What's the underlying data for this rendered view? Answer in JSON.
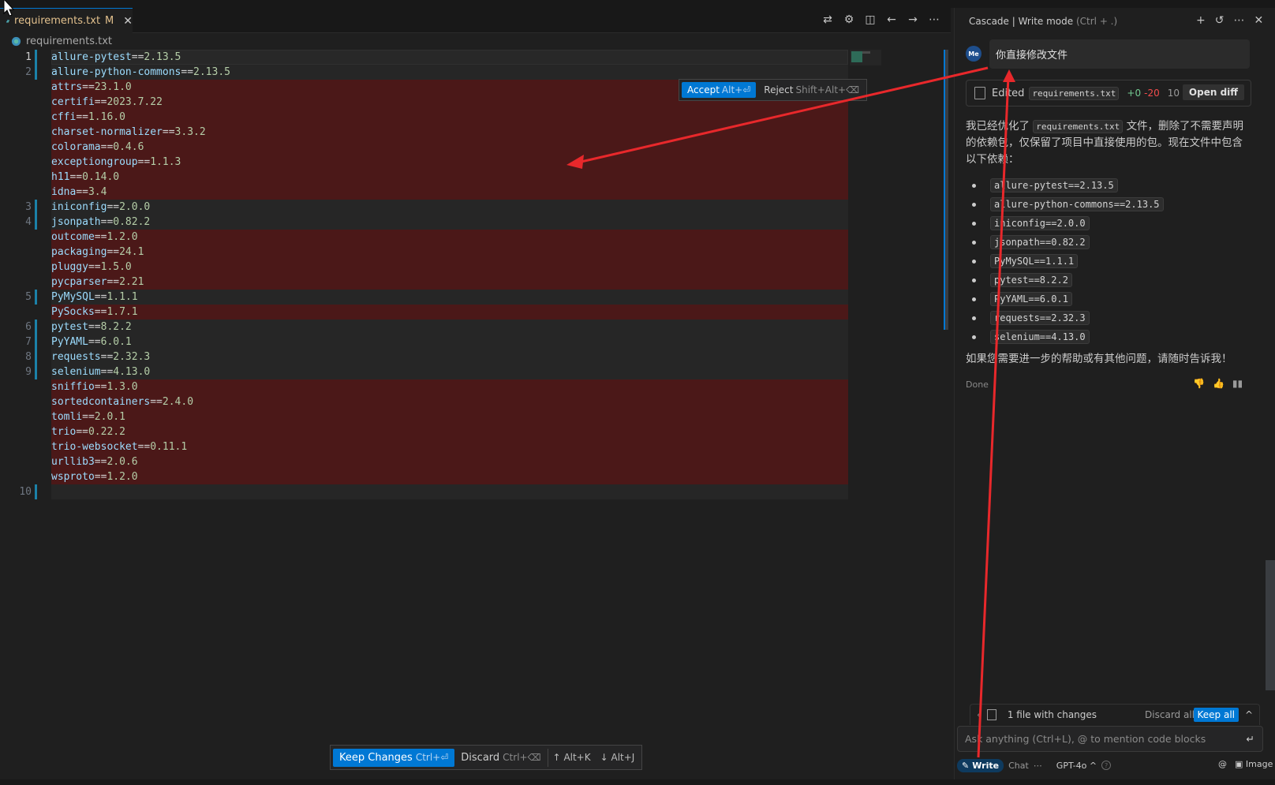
{
  "editor": {
    "tab": {
      "filename": "requirements.txt",
      "modified": "M",
      "close": "✕"
    },
    "breadcrumb": "requirements.txt",
    "lines": [
      {
        "num": "1",
        "name": "allure-pytest",
        "version": "2.13.5",
        "state": "cur"
      },
      {
        "num": "2",
        "name": "allure-python-commons",
        "version": "2.13.5",
        "state": "kept"
      },
      {
        "num": "",
        "name": "attrs",
        "version": "23.1.0",
        "state": "del"
      },
      {
        "num": "",
        "name": "certifi",
        "version": "2023.7.22",
        "state": "del"
      },
      {
        "num": "",
        "name": "cffi",
        "version": "1.16.0",
        "state": "del"
      },
      {
        "num": "",
        "name": "charset-normalizer",
        "version": "3.3.2",
        "state": "del"
      },
      {
        "num": "",
        "name": "colorama",
        "version": "0.4.6",
        "state": "del"
      },
      {
        "num": "",
        "name": "exceptiongroup",
        "version": "1.1.3",
        "state": "del"
      },
      {
        "num": "",
        "name": "h11",
        "version": "0.14.0",
        "state": "del"
      },
      {
        "num": "",
        "name": "idna",
        "version": "3.4",
        "state": "del"
      },
      {
        "num": "3",
        "name": "iniconfig",
        "version": "2.0.0",
        "state": "kept"
      },
      {
        "num": "4",
        "name": "jsonpath",
        "version": "0.82.2",
        "state": "kept"
      },
      {
        "num": "",
        "name": "outcome",
        "version": "1.2.0",
        "state": "del"
      },
      {
        "num": "",
        "name": "packaging",
        "version": "24.1",
        "state": "del"
      },
      {
        "num": "",
        "name": "pluggy",
        "version": "1.5.0",
        "state": "del"
      },
      {
        "num": "",
        "name": "pycparser",
        "version": "2.21",
        "state": "del"
      },
      {
        "num": "5",
        "name": "PyMySQL",
        "version": "1.1.1",
        "state": "kept"
      },
      {
        "num": "",
        "name": "PySocks",
        "version": "1.7.1",
        "state": "del"
      },
      {
        "num": "6",
        "name": "pytest",
        "version": "8.2.2",
        "state": "kept"
      },
      {
        "num": "7",
        "name": "PyYAML",
        "version": "6.0.1",
        "state": "kept"
      },
      {
        "num": "8",
        "name": "requests",
        "version": "2.32.3",
        "state": "kept"
      },
      {
        "num": "9",
        "name": "selenium",
        "version": "4.13.0",
        "state": "kept"
      },
      {
        "num": "",
        "name": "sniffio",
        "version": "1.3.0",
        "state": "del"
      },
      {
        "num": "",
        "name": "sortedcontainers",
        "version": "2.4.0",
        "state": "del"
      },
      {
        "num": "",
        "name": "tomli",
        "version": "2.0.1",
        "state": "del"
      },
      {
        "num": "",
        "name": "trio",
        "version": "0.22.2",
        "state": "del"
      },
      {
        "num": "",
        "name": "trio-websocket",
        "version": "0.11.1",
        "state": "del"
      },
      {
        "num": "",
        "name": "urllib3",
        "version": "2.0.6",
        "state": "del"
      },
      {
        "num": "",
        "name": "wsproto",
        "version": "1.2.0",
        "state": "del"
      },
      {
        "num": "10",
        "name": "",
        "version": "",
        "state": "kept"
      }
    ],
    "accept": {
      "label": "Accept",
      "shortcut": "Alt+⏎"
    },
    "reject": {
      "label": "Reject",
      "shortcut": "Shift+Alt+⌫"
    },
    "keepbar": {
      "keep_label": "Keep Changes",
      "keep_shortcut": "Ctrl+⏎",
      "discard_label": "Discard",
      "discard_shortcut": "Ctrl+⌫",
      "prev": "Alt+K",
      "next": "Alt+J"
    }
  },
  "panel": {
    "title": "Cascade | Write mode",
    "title_shortcut": "(Ctrl + .)",
    "avatar": "Me",
    "user_message": "你直接修改文件",
    "edit_card": {
      "label": "Edited",
      "file": "requirements.txt",
      "added": "+0",
      "removed": "-20",
      "count": "10",
      "open_diff": "Open diff"
    },
    "response_pre": "我已经优化了",
    "response_file": "requirements.txt",
    "response_post": "文件，删除了不需要声明的依赖包，仅保留了项目中直接使用的包。现在文件中包含以下依赖：",
    "deps": [
      "allure-pytest==2.13.5",
      "allure-python-commons==2.13.5",
      "iniconfig==2.0.0",
      "jsonpath==0.82.2",
      "PyMySQL==1.1.1",
      "pytest==8.2.2",
      "PyYAML==6.0.1",
      "requests==2.32.3",
      "selenium==4.13.0"
    ],
    "closing": "如果您需要进一步的帮助或有其他问题，请随时告诉我！",
    "done": "Done",
    "changes": {
      "label": "1 file with changes",
      "discard_all": "Discard all",
      "keep_all": "Keep all"
    },
    "input_placeholder": "Ask anything (Ctrl+L), @ to mention code blocks",
    "write": "Write",
    "chat": "Chat",
    "model": "GPT-4o",
    "image": "Image"
  },
  "colors": {
    "accent": "#0078d4",
    "deleted_line": "#4b1818",
    "annotation": "#e8282b"
  }
}
